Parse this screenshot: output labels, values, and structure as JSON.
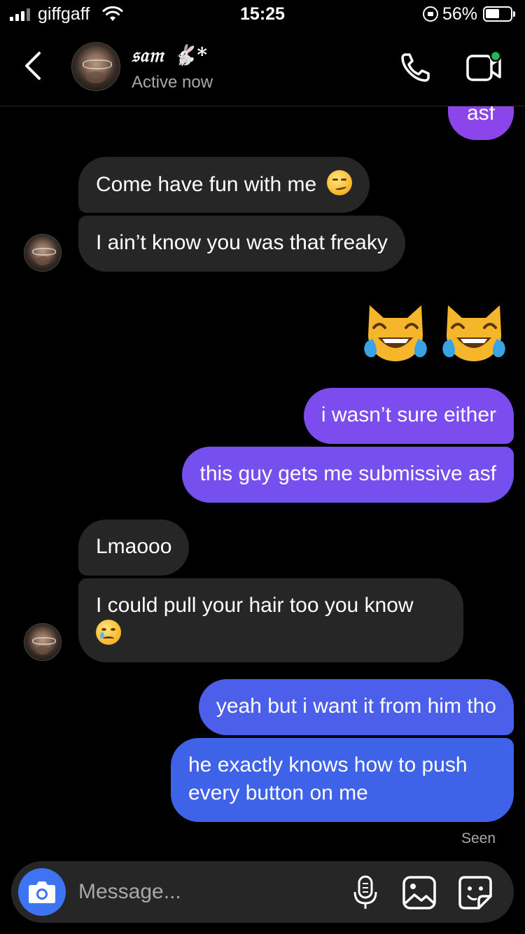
{
  "status_bar": {
    "carrier": "giffgaff",
    "time": "15:25",
    "battery_percent": "56%"
  },
  "header": {
    "contact_name": "𝔰𝔞𝔪 🐇*",
    "status": "Active now",
    "online_indicator_color": "#1db954"
  },
  "messages": [
    {
      "from": "me",
      "text": "asf"
    },
    {
      "from": "them",
      "text": "Come have fun with me",
      "emoji": "smirk-face"
    },
    {
      "from": "them",
      "text": "I ain’t know you was that freaky"
    },
    {
      "from": "me",
      "emoji": "cat-with-tears-of-joy",
      "count": 2
    },
    {
      "from": "me",
      "text": "i wasn’t sure either"
    },
    {
      "from": "me",
      "text": "this guy gets me submissive asf"
    },
    {
      "from": "them",
      "text": "Lmaooo"
    },
    {
      "from": "them",
      "text": "I could pull your hair too you know",
      "emoji": "face-holding-back-tears"
    },
    {
      "from": "me",
      "text": "yeah but i want it from him tho"
    },
    {
      "from": "me",
      "text": "he exactly knows how to push every button on me"
    }
  ],
  "receipt": "Seen",
  "composer": {
    "placeholder": "Message..."
  },
  "colors": {
    "background": "#000000",
    "incoming_bubble": "#262626",
    "outgoing_gradient_top": "#9b3fe6",
    "outgoing_gradient_bottom": "#3f63e8",
    "accent_blue": "#3e74f2"
  }
}
